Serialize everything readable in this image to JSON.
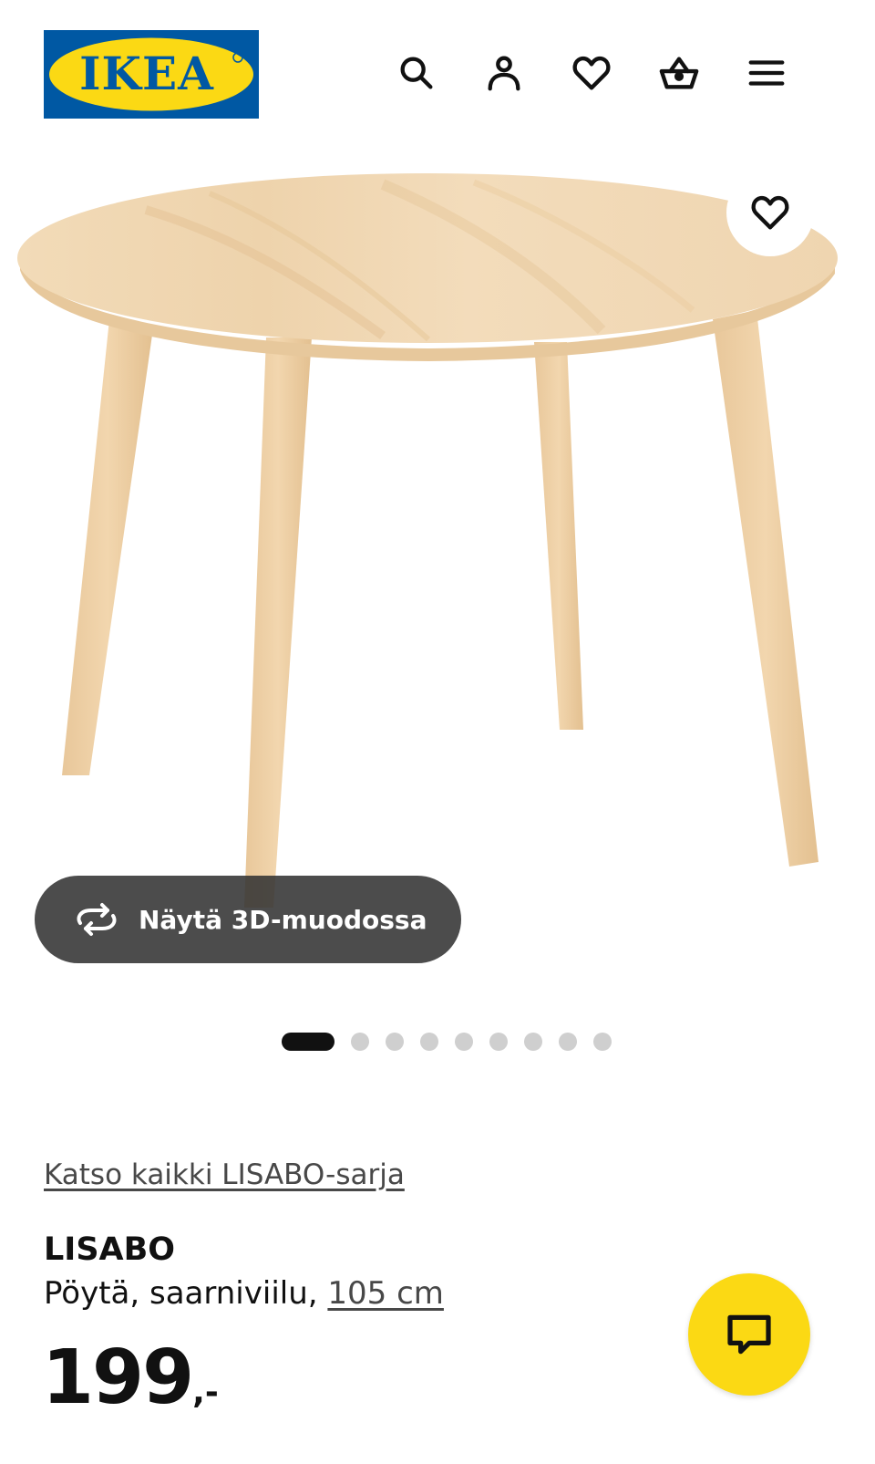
{
  "header": {
    "logo_text": "IKEA",
    "icons": [
      "search-icon",
      "account-icon",
      "heart-icon",
      "basket-icon",
      "menu-icon"
    ]
  },
  "gallery": {
    "view_3d_label": "Näytä 3D-muodossa",
    "slide_count": 9,
    "active_slide": 1
  },
  "product": {
    "series_link": "Katso kaikki LISABO-sarja",
    "name": "LISABO",
    "description_prefix": "Pöytä, saarniviilu, ",
    "size_link": "105 cm",
    "price_amount": "199",
    "price_suffix": ",-"
  },
  "colors": {
    "brand_blue": "#0058a3",
    "brand_yellow": "#fbd914",
    "text": "#111111"
  }
}
